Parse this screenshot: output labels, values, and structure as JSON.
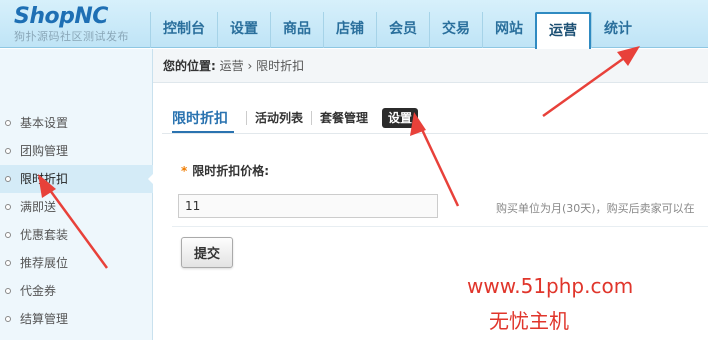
{
  "header": {
    "logo_text": "ShopNC",
    "logo_sub": "狗扑源码社区测试发布",
    "nav": [
      {
        "label": "控制台"
      },
      {
        "label": "设置"
      },
      {
        "label": "商品"
      },
      {
        "label": "店铺"
      },
      {
        "label": "会员"
      },
      {
        "label": "交易"
      },
      {
        "label": "网站"
      },
      {
        "label": "运营",
        "active": true
      },
      {
        "label": "统计"
      }
    ]
  },
  "breadcrumb": {
    "label": "您的位置:",
    "path1": "运营",
    "sep": "›",
    "path2": "限时折扣"
  },
  "sidebar": {
    "items": [
      {
        "label": "基本设置"
      },
      {
        "label": "团购管理"
      },
      {
        "label": "限时折扣",
        "active": true
      },
      {
        "label": "满即送"
      },
      {
        "label": "优惠套装"
      },
      {
        "label": "推荐展位"
      },
      {
        "label": "代金券"
      },
      {
        "label": "结算管理"
      }
    ]
  },
  "tabs": {
    "title": "限时折扣",
    "items": [
      {
        "label": "活动列表"
      },
      {
        "label": "套餐管理"
      },
      {
        "label": "设置",
        "selected": true
      }
    ]
  },
  "form": {
    "required_mark": "*",
    "price_label": "限时折扣价格:",
    "price_value": "11",
    "hint": "购买单位为月(30天)，购买后卖家可以在",
    "submit_label": "提交"
  },
  "watermark": {
    "url": "www.51php.com",
    "name": "无忧主机"
  },
  "colors": {
    "accent": "#2a73b0",
    "arrow": "#e8413a",
    "header_bg": "#c9e9f8"
  }
}
